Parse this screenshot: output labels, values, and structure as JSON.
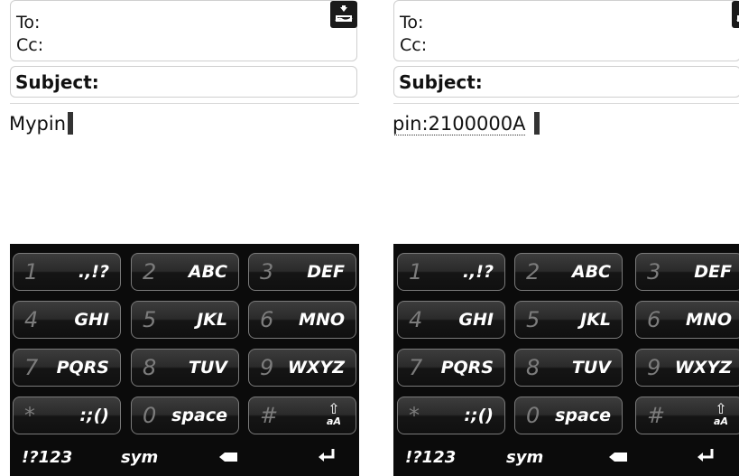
{
  "screens": [
    {
      "header": {
        "to_label": "To:",
        "cc_label": "Cc:",
        "attach_icon": "attachment-tray-icon"
      },
      "subject": {
        "label": "Subject:"
      },
      "body": {
        "text": "Mypin",
        "link_text": ""
      }
    },
    {
      "header": {
        "to_label": "To:",
        "cc_label": "Cc:",
        "attach_icon": "attachment-tray-icon"
      },
      "subject": {
        "label": "Subject:"
      },
      "body": {
        "text": "",
        "link_text": "pin:2100000A"
      }
    }
  ],
  "keyboard": {
    "keys": [
      [
        {
          "num": "1",
          "letters": ".,!?"
        },
        {
          "num": "2",
          "letters": "ABC"
        },
        {
          "num": "3",
          "letters": "DEF"
        }
      ],
      [
        {
          "num": "4",
          "letters": "GHI"
        },
        {
          "num": "5",
          "letters": "JKL"
        },
        {
          "num": "6",
          "letters": "MNO"
        }
      ],
      [
        {
          "num": "7",
          "letters": "PQRS"
        },
        {
          "num": "8",
          "letters": "TUV"
        },
        {
          "num": "9",
          "letters": "WXYZ"
        }
      ],
      [
        {
          "num": "*",
          "letters": ":;()"
        },
        {
          "num": "0",
          "letters": "space"
        },
        {
          "num": "#",
          "letters": "aA"
        }
      ]
    ],
    "bottom": {
      "num_sym": "!?123",
      "sym": "sym",
      "backspace_icon": "backspace-icon",
      "enter_icon": "enter-icon"
    }
  },
  "colors": {
    "keyboard_bg": "#0b0b0b",
    "key_border": "#7a7a7a",
    "key_digit": "#7c7c7c",
    "text": "#111111"
  }
}
